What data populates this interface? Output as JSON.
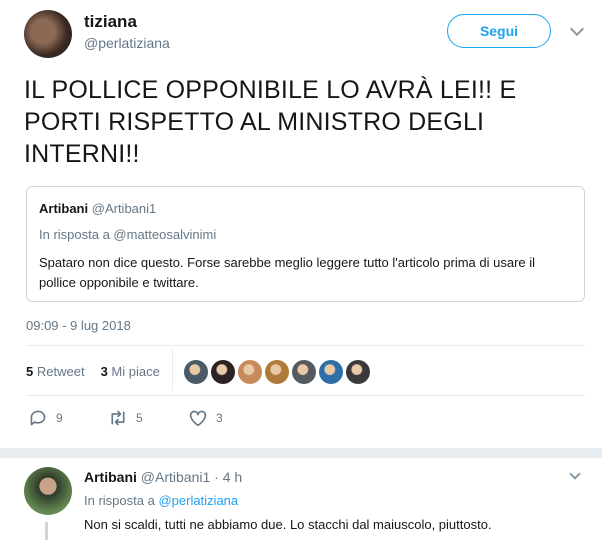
{
  "tweet": {
    "author_name": "tiziana",
    "author_handle": "@perlatiziana",
    "follow_label": "Segui",
    "text": "IL POLLICE OPPONIBILE LO AVRÀ LEI!! E PORTI RISPETTO AL MINISTRO DEGLI INTERNI!!",
    "timestamp": "09:09 - 9 lug 2018"
  },
  "quoted": {
    "author_name": "Artibani",
    "author_handle": "@Artibani1",
    "reply_to": "In risposta a @matteosalvinimi",
    "text": "Spataro non dice questo. Forse sarebbe meglio leggere tutto l'articolo prima di usare il pollice opponibile e twittare."
  },
  "stats": {
    "retweets_count": "5",
    "retweets_label": "Retweet",
    "likes_count": "3",
    "likes_label": "Mi piace"
  },
  "likers": [
    {
      "name": "liker-1",
      "color": "#4a5a66"
    },
    {
      "name": "liker-2",
      "color": "#2b2321"
    },
    {
      "name": "liker-3",
      "color": "#c98a5a"
    },
    {
      "name": "liker-4",
      "color": "#b07a3a"
    },
    {
      "name": "liker-5",
      "color": "#555a5e"
    },
    {
      "name": "liker-6",
      "color": "#2e6fa8"
    },
    {
      "name": "liker-7",
      "color": "#3a3a3a"
    }
  ],
  "actions": {
    "reply_count": "9",
    "retweet_count": "5",
    "like_count": "3"
  },
  "reply": {
    "author_name": "Artibani",
    "author_handle": "@Artibani1",
    "time": "4 h",
    "reply_prefix": "In risposta a",
    "reply_to": "@perlatiziana",
    "text": "Non si scaldi, tutti ne abbiamo due. Lo stacchi dal maiuscolo, piuttosto."
  },
  "colors": {
    "accent": "#1da1f2",
    "secondary_text": "#657786",
    "border": "#e6ecf0"
  }
}
